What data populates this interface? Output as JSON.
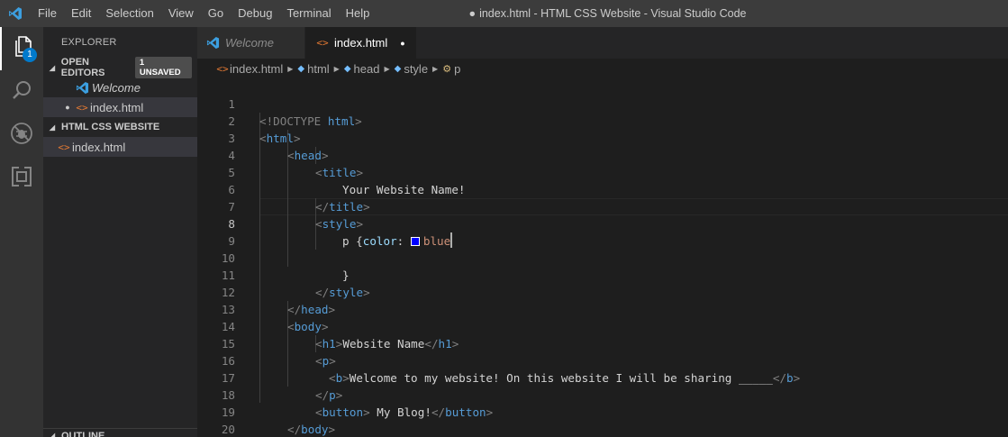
{
  "titlebar": {
    "menu": [
      "File",
      "Edit",
      "Selection",
      "View",
      "Go",
      "Debug",
      "Terminal",
      "Help"
    ],
    "dirty_dot": "●",
    "title": "index.html - HTML CSS Website - Visual Studio Code"
  },
  "activitybar": {
    "items": [
      {
        "icon": "files-icon"
      },
      {
        "icon": "search-icon"
      },
      {
        "icon": "debug-icon"
      },
      {
        "icon": "extensions-icon"
      }
    ],
    "badge": "1"
  },
  "sidebar": {
    "title": "EXPLORER",
    "open_editors": {
      "label": "OPEN EDITORS",
      "badge": "1 UNSAVED",
      "items": [
        {
          "name": "Welcome",
          "icon": "vscode-icon"
        },
        {
          "name": "index.html",
          "icon": "html-icon",
          "dirty": "●"
        }
      ]
    },
    "workspace": {
      "label": "HTML CSS WEBSITE",
      "items": [
        {
          "name": "index.html",
          "icon": "html-icon"
        }
      ]
    },
    "outline": "OUTLINE"
  },
  "tabs": [
    {
      "label": "Welcome",
      "active": false
    },
    {
      "label": "index.html",
      "active": true,
      "dirty": "●"
    }
  ],
  "breadcrumb": {
    "file": "index.html",
    "items": [
      "html",
      "head",
      "style",
      "p"
    ]
  },
  "editor": {
    "current_line": 8,
    "lines": [
      {
        "n": "1"
      },
      {
        "n": "2"
      },
      {
        "n": "3"
      },
      {
        "n": "4"
      },
      {
        "n": "5"
      },
      {
        "n": "6"
      },
      {
        "n": "7"
      },
      {
        "n": "8"
      },
      {
        "n": "9"
      },
      {
        "n": "10"
      },
      {
        "n": "11"
      },
      {
        "n": "12"
      },
      {
        "n": "13"
      },
      {
        "n": "14"
      },
      {
        "n": "15"
      },
      {
        "n": "16"
      },
      {
        "n": "17"
      },
      {
        "n": "18"
      },
      {
        "n": "19"
      },
      {
        "n": "20"
      }
    ],
    "code": {
      "doctype_open": "<!DOCTYPE",
      "doctype_html": " html",
      "doctype_close": ">",
      "html": "html",
      "head": "head",
      "title": "title",
      "title_text": "Your Website Name!",
      "style": "style",
      "css_selector": "p {",
      "css_prop": "color",
      "css_colon": ":",
      "css_value": "blue",
      "css_close": "}",
      "body": "body",
      "h1": "h1",
      "h1_text": "Website Name",
      "p": "p",
      "b": "b",
      "b_text": "Welcome to my website! On this website I will be sharing _____",
      "button": "button",
      "button_text": " My Blog!"
    }
  }
}
